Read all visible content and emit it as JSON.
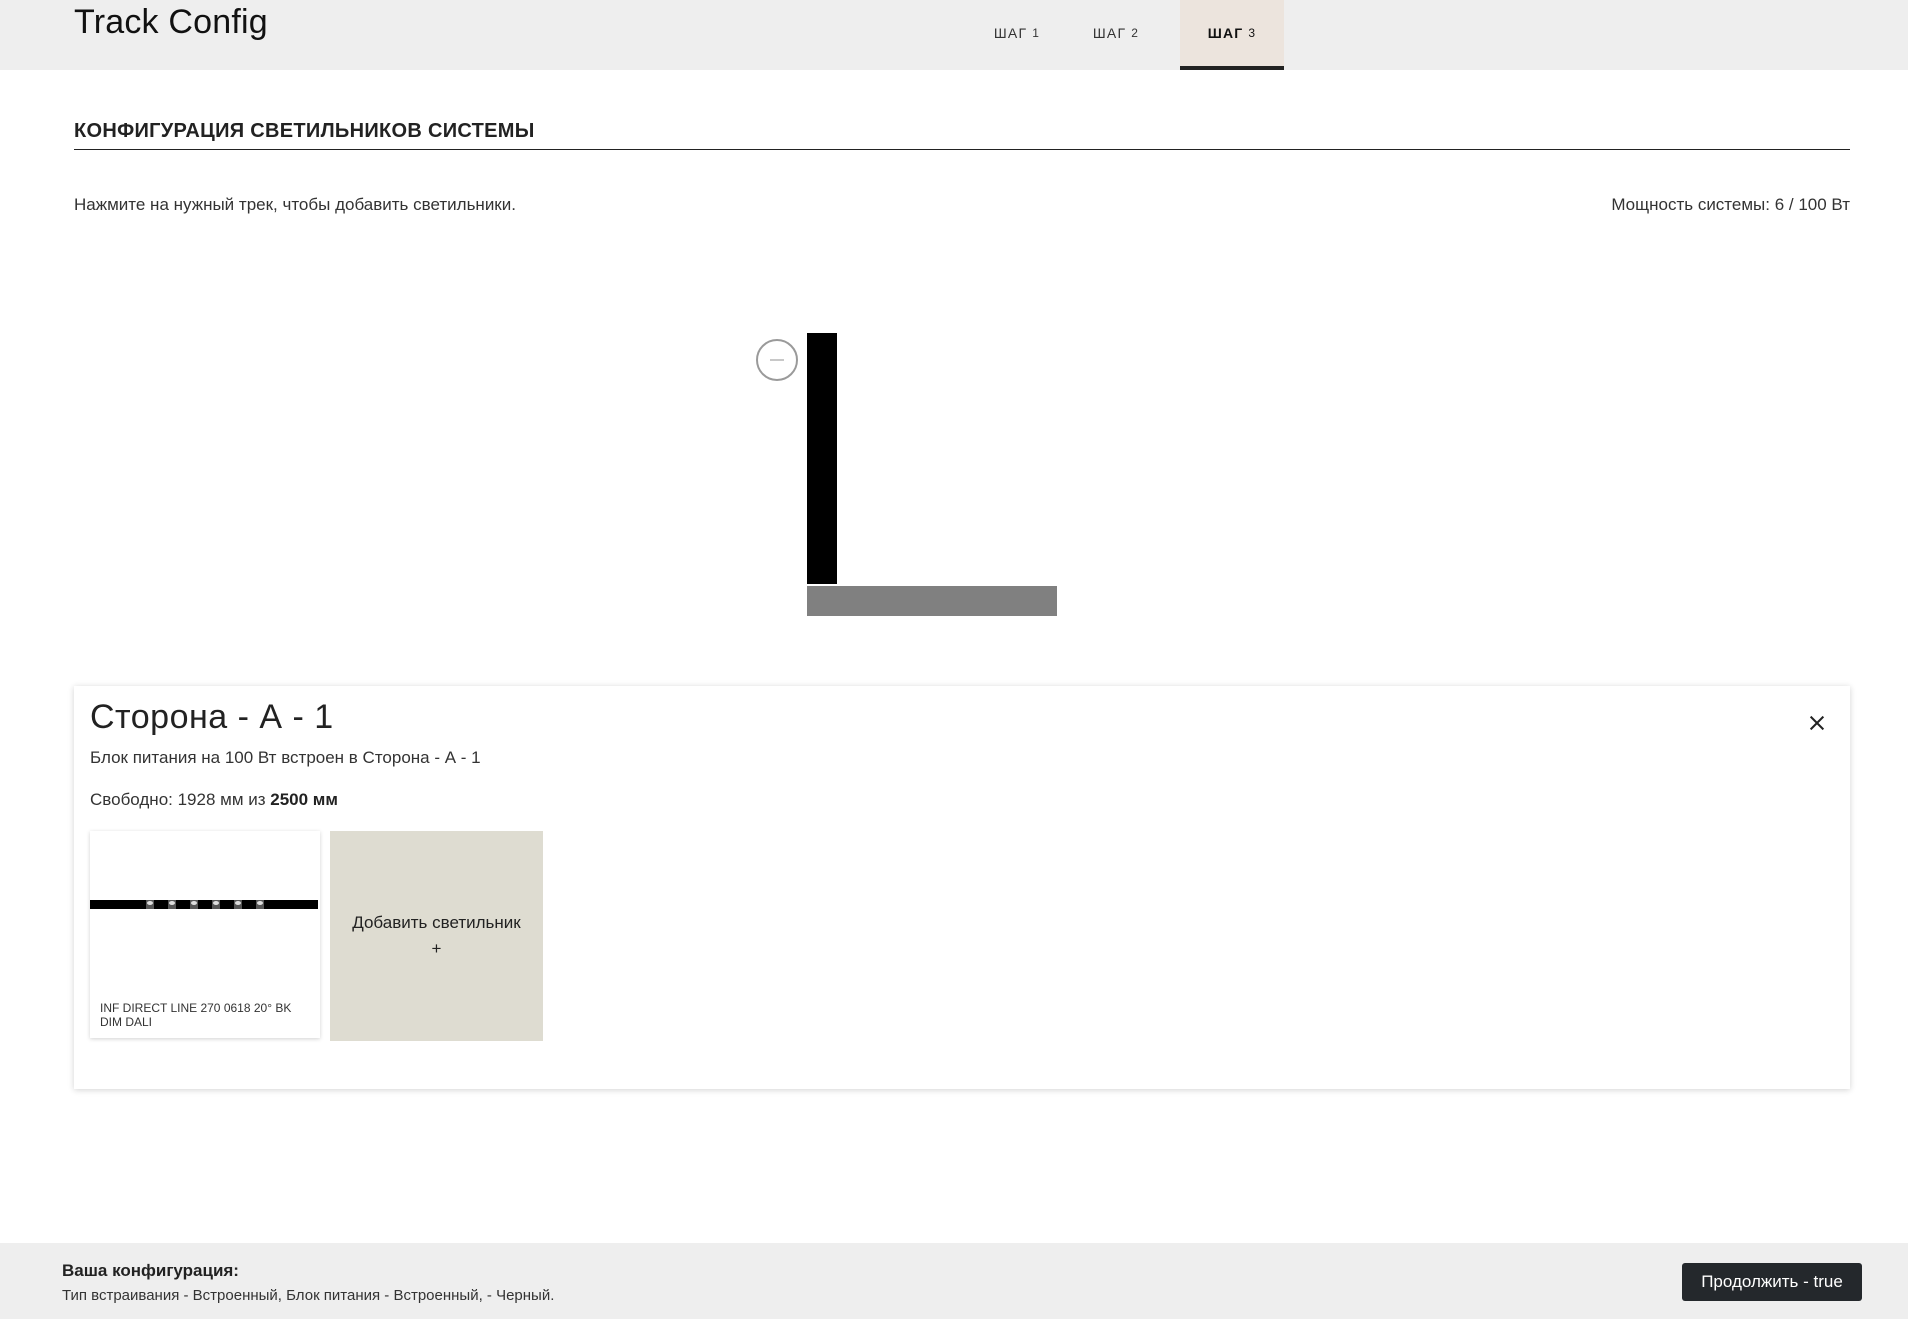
{
  "header": {
    "title": "Track Config",
    "tabs": [
      {
        "label": "ШАГ",
        "num": "1"
      },
      {
        "label": "ШАГ",
        "num": "2"
      },
      {
        "label": "ШАГ",
        "num": "3"
      }
    ],
    "active_tab": "3"
  },
  "main": {
    "section_title": "КОНФИГУРАЦИЯ СВЕТИЛЬНИКОВ СИСТЕМЫ",
    "hint": "Нажмите на нужный трек, чтобы добавить светильники.",
    "power": "Мощность системы: 6 / 100 Вт"
  },
  "panel": {
    "title": "Сторона - А - 1",
    "description": "Блок питания на 100 Вт встроен в Сторона - А - 1",
    "free_prefix": "Свободно: 1928 мм из",
    "free_total": "2500 мм",
    "product_name": "INF DIRECT LINE 270 0618 20° BK DIM DALI",
    "add_label": "Добавить светильник",
    "add_plus": "+"
  },
  "footer": {
    "title": "Ваша конфигурация:",
    "summary": "Тип встраивания - Встроенный, Блок питания - Встроенный, - Черный.",
    "continue_label": "Продолжить - true"
  },
  "colors": {
    "header_bg": "#eeeeee",
    "active_tab_bg": "#ece4dd",
    "track_selected": "#000000",
    "track_other": "#808080",
    "add_card_bg": "#dedcd1",
    "button_bg": "#24282c"
  }
}
